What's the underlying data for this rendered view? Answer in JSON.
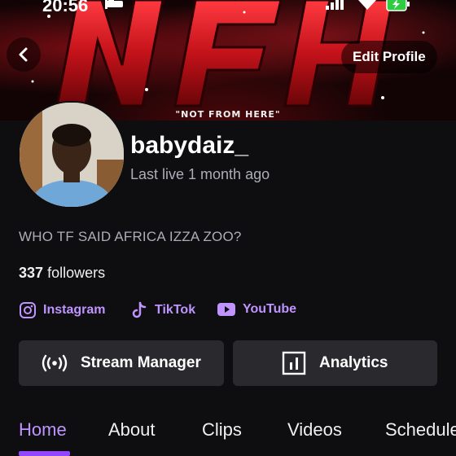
{
  "status_bar": {
    "time": "20:56"
  },
  "banner": {
    "tagline": "\"NOT FROM HERE\"",
    "logo_text": "NFH",
    "edit_profile_label": "Edit Profile"
  },
  "profile": {
    "username": "babydaiz_",
    "last_live": "Last live 1 month ago",
    "bio": "WHO TF SAID AFRICA IZZA ZOO?",
    "followers_count": "337",
    "followers_label": "followers"
  },
  "socials": [
    {
      "label": "Instagram",
      "icon": "instagram-icon"
    },
    {
      "label": "TikTok",
      "icon": "tiktok-icon"
    },
    {
      "label": "YouTube",
      "icon": "youtube-icon"
    }
  ],
  "actions": {
    "stream_manager_label": "Stream Manager",
    "analytics_label": "Analytics"
  },
  "tabs": [
    {
      "label": "Home",
      "active": true
    },
    {
      "label": "About",
      "active": false
    },
    {
      "label": "Clips",
      "active": false
    },
    {
      "label": "Videos",
      "active": false
    },
    {
      "label": "Schedule",
      "active": false
    }
  ],
  "colors": {
    "background": "#0e0e10",
    "accent": "#bf94ff",
    "accent_strong": "#9147ff",
    "button_bg": "#2a2a2e",
    "muted_text": "#adadb8",
    "banner_red": "#d4141e"
  }
}
